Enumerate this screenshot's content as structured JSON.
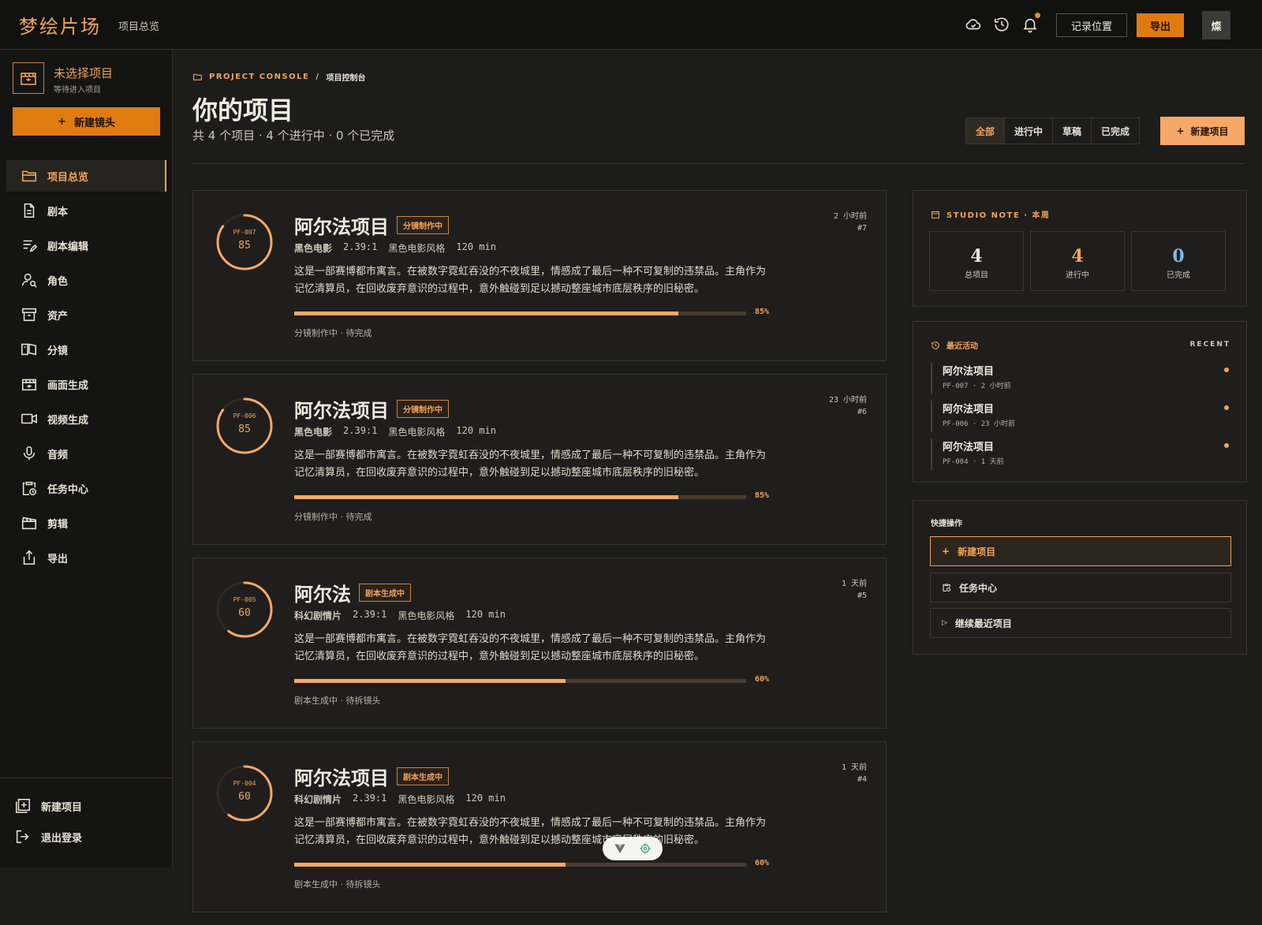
{
  "app": {
    "brand": "梦绘片场",
    "breadcrumb": "项目总览"
  },
  "topbar": {
    "record_label": "记录位置",
    "export_label": "导出",
    "avatar_text": "燦",
    "icons": [
      "cloud-sync-icon",
      "history-icon",
      "bell-icon"
    ]
  },
  "sidebar": {
    "project_title": "未选择项目",
    "project_sub": "等待进入项目",
    "new_shot": "新建镜头",
    "items": [
      {
        "label": "项目总览",
        "icon": "folder-icon"
      },
      {
        "label": "剧本",
        "icon": "document-icon"
      },
      {
        "label": "剧本编辑",
        "icon": "edit-list-icon"
      },
      {
        "label": "角色",
        "icon": "character-search-icon"
      },
      {
        "label": "资产",
        "icon": "archive-icon"
      },
      {
        "label": "分镜",
        "icon": "storyboard-icon"
      },
      {
        "label": "画面生成",
        "icon": "image-gen-icon"
      },
      {
        "label": "视频生成",
        "icon": "video-icon"
      },
      {
        "label": "音频",
        "icon": "microphone-icon"
      },
      {
        "label": "任务中心",
        "icon": "clipboard-clock-icon"
      },
      {
        "label": "剪辑",
        "icon": "clapper-icon"
      },
      {
        "label": "导出",
        "icon": "share-icon"
      }
    ],
    "bottom": {
      "new_project": "新建项目",
      "logout": "退出登录"
    }
  },
  "main": {
    "console_en": "PROJECT CONSOLE",
    "console_sep": "/",
    "console_zh": "项目控制台",
    "title": "你的项目",
    "summary": "共 4 个项目 · 4 个进行中 · 0 个已完成",
    "filters": [
      "全部",
      "进行中",
      "草稿",
      "已完成"
    ],
    "new_project": "新建项目"
  },
  "projects": [
    {
      "code": "PF-007",
      "progress": 85,
      "progress_label": "85%",
      "title": "阿尔法项目",
      "badge": "分镜制作中",
      "genre": "黑色电影",
      "ratio": "2.39:1",
      "style": "黑色电影风格",
      "duration": "120 min",
      "desc": "这是一部赛博都市寓言。在被数字霓虹吞没的不夜城里，情感成了最后一种不可复制的违禁品。主角作为记忆清算员，在回收废弃意识的过程中，意外触碰到足以撼动整座城市底层秩序的旧秘密。",
      "status": "分镜制作中 · 待完成",
      "time": "2 小时前",
      "num": "#7"
    },
    {
      "code": "PF-006",
      "progress": 85,
      "progress_label": "85%",
      "title": "阿尔法项目",
      "badge": "分镜制作中",
      "genre": "黑色电影",
      "ratio": "2.39:1",
      "style": "黑色电影风格",
      "duration": "120 min",
      "desc": "这是一部赛博都市寓言。在被数字霓虹吞没的不夜城里，情感成了最后一种不可复制的违禁品。主角作为记忆清算员，在回收废弃意识的过程中，意外触碰到足以撼动整座城市底层秩序的旧秘密。",
      "status": "分镜制作中 · 待完成",
      "time": "23 小时前",
      "num": "#6"
    },
    {
      "code": "PF-005",
      "progress": 60,
      "progress_label": "60%",
      "title": "阿尔法",
      "badge": "剧本生成中",
      "genre": "科幻剧情片",
      "ratio": "2.39:1",
      "style": "黑色电影风格",
      "duration": "120 min",
      "desc": "这是一部赛博都市寓言。在被数字霓虹吞没的不夜城里，情感成了最后一种不可复制的违禁品。主角作为记忆清算员，在回收废弃意识的过程中，意外触碰到足以撼动整座城市底层秩序的旧秘密。",
      "status": "剧本生成中 · 待拆镜头",
      "time": "1 天前",
      "num": "#5"
    },
    {
      "code": "PF-004",
      "progress": 60,
      "progress_label": "60%",
      "title": "阿尔法项目",
      "badge": "剧本生成中",
      "genre": "科幻剧情片",
      "ratio": "2.39:1",
      "style": "黑色电影风格",
      "duration": "120 min",
      "desc": "这是一部赛博都市寓言。在被数字霓虹吞没的不夜城里，情感成了最后一种不可复制的违禁品。主角作为记忆清算员，在回收废弃意识的过程中，意外触碰到足以撼动整座城市底层秩序的旧秘密。",
      "status": "剧本生成中 · 待拆镜头",
      "time": "1 天前",
      "num": "#4"
    }
  ],
  "studio_note": {
    "title": "STUDIO NOTE · 本周",
    "stats": [
      {
        "value": "4",
        "label": "总项目",
        "color": "#ece4d8"
      },
      {
        "value": "4",
        "label": "进行中",
        "color": "#f0a35a"
      },
      {
        "value": "0",
        "label": "已完成",
        "color": "#7fb6e8"
      }
    ]
  },
  "recent": {
    "title": "最近活动",
    "tag": "RECENT",
    "items": [
      {
        "title": "阿尔法项目",
        "sub": "PF-007 · 2 小时前"
      },
      {
        "title": "阿尔法项目",
        "sub": "PF-006 · 23 小时前"
      },
      {
        "title": "阿尔法项目",
        "sub": "PF-004 · 1 天前"
      }
    ]
  },
  "quick": {
    "title": "快捷操作",
    "items": [
      {
        "label": "新建项目",
        "icon": "plus-icon"
      },
      {
        "label": "任务中心",
        "icon": "clipboard-clock-icon"
      },
      {
        "label": "继续最近项目",
        "icon": "play-icon"
      }
    ]
  },
  "colors": {
    "accent": "#f0a35a",
    "accent_strong": "#e07b10",
    "background": "#1c1c1a"
  }
}
